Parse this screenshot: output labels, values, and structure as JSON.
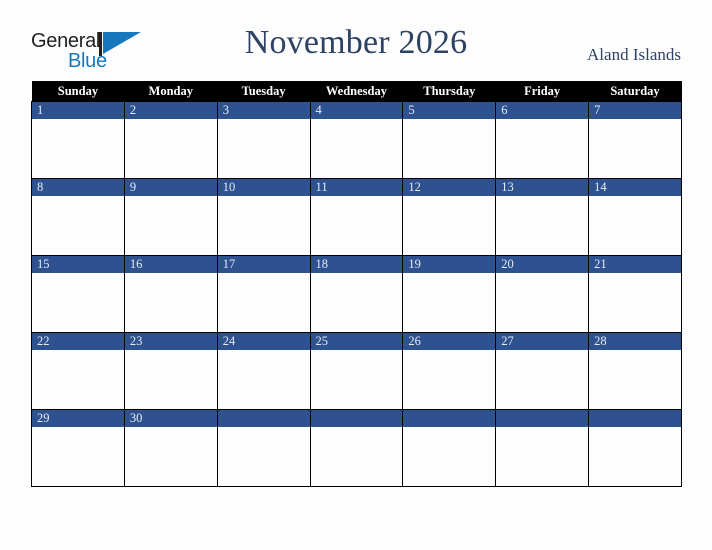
{
  "brand": {
    "name_part1": "General",
    "name_part2": "Blue",
    "mark": "triangle-logo-mark",
    "colors": {
      "dark": "#231f20",
      "blue": "#1878be"
    }
  },
  "header": {
    "title": "November 2026",
    "country": "Aland Islands",
    "title_color": "#2d4265"
  },
  "calendar": {
    "weekday_headers": [
      "Sunday",
      "Monday",
      "Tuesday",
      "Wednesday",
      "Thursday",
      "Friday",
      "Saturday"
    ],
    "header_background": "#000000",
    "header_text_color": "#ffffff",
    "date_band_color": "#2e5190",
    "date_text_color": "#e8ecf4",
    "cell_background": "#fdfdfd",
    "grid_line_color": "#000000",
    "weeks": [
      {
        "days": [
          {
            "date": "1",
            "note": ""
          },
          {
            "date": "2",
            "note": ""
          },
          {
            "date": "3",
            "note": ""
          },
          {
            "date": "4",
            "note": ""
          },
          {
            "date": "5",
            "note": ""
          },
          {
            "date": "6",
            "note": ""
          },
          {
            "date": "7",
            "note": ""
          }
        ]
      },
      {
        "days": [
          {
            "date": "8",
            "note": ""
          },
          {
            "date": "9",
            "note": ""
          },
          {
            "date": "10",
            "note": ""
          },
          {
            "date": "11",
            "note": ""
          },
          {
            "date": "12",
            "note": ""
          },
          {
            "date": "13",
            "note": ""
          },
          {
            "date": "14",
            "note": ""
          }
        ]
      },
      {
        "days": [
          {
            "date": "15",
            "note": ""
          },
          {
            "date": "16",
            "note": ""
          },
          {
            "date": "17",
            "note": ""
          },
          {
            "date": "18",
            "note": ""
          },
          {
            "date": "19",
            "note": ""
          },
          {
            "date": "20",
            "note": ""
          },
          {
            "date": "21",
            "note": ""
          }
        ]
      },
      {
        "days": [
          {
            "date": "22",
            "note": ""
          },
          {
            "date": "23",
            "note": ""
          },
          {
            "date": "24",
            "note": ""
          },
          {
            "date": "25",
            "note": ""
          },
          {
            "date": "26",
            "note": ""
          },
          {
            "date": "27",
            "note": ""
          },
          {
            "date": "28",
            "note": ""
          }
        ]
      },
      {
        "days": [
          {
            "date": "29",
            "note": ""
          },
          {
            "date": "30",
            "note": ""
          },
          {
            "date": "",
            "note": ""
          },
          {
            "date": "",
            "note": ""
          },
          {
            "date": "",
            "note": ""
          },
          {
            "date": "",
            "note": ""
          },
          {
            "date": "",
            "note": ""
          }
        ]
      }
    ]
  }
}
